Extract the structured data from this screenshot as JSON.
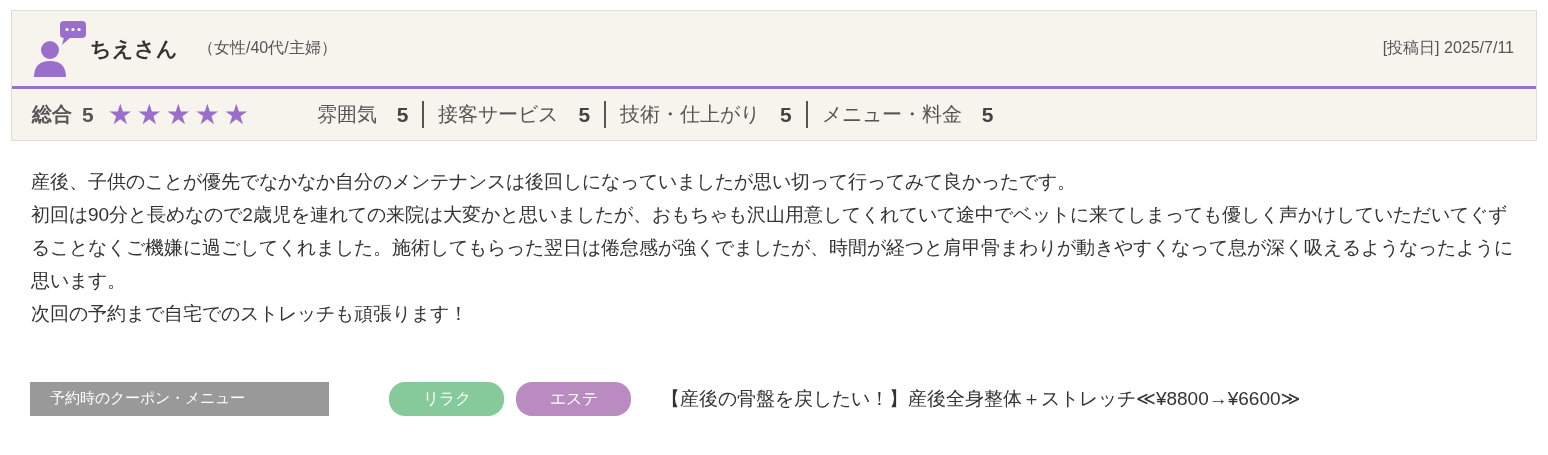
{
  "reviewer": {
    "name": "ちえさん",
    "profile": "（女性/40代/主婦）",
    "posted": "[投稿日] 2025/7/11"
  },
  "rating": {
    "label": "総合",
    "score": "5",
    "stars": 5,
    "categories": [
      {
        "label": "雰囲気",
        "score": "5"
      },
      {
        "label": "接客サービス",
        "score": "5"
      },
      {
        "label": "技術・仕上がり",
        "score": "5"
      },
      {
        "label": "メニュー・料金",
        "score": "5"
      }
    ]
  },
  "review": [
    "産後、子供のことが優先でなかなか自分のメンテナンスは後回しになっていましたが思い切って行ってみて良かったです。",
    "初回は90分と長めなので2歳児を連れての来院は大変かと思いましたが、おもちゃも沢山用意してくれていて途中でベットに来てしまっても優しく声かけしていただいてぐずることなくご機嫌に過ごしてくれました。施術してもらった翌日は倦怠感が強くでましたが、時間が経つと肩甲骨まわりが動きやすくなって息が深く吸えるようなったように思います。",
    "次回の予約まで自宅でのストレッチも頑張ります！"
  ],
  "coupon": {
    "label": "予約時のクーポン・メニュー",
    "tags": [
      {
        "label": "リラク",
        "color": "#86c99b"
      },
      {
        "label": "エステ",
        "color": "#b98bc0"
      }
    ],
    "text": "【産後の骨盤を戻したい！】産後全身整体＋ストレッチ≪¥8800→¥6600≫"
  }
}
